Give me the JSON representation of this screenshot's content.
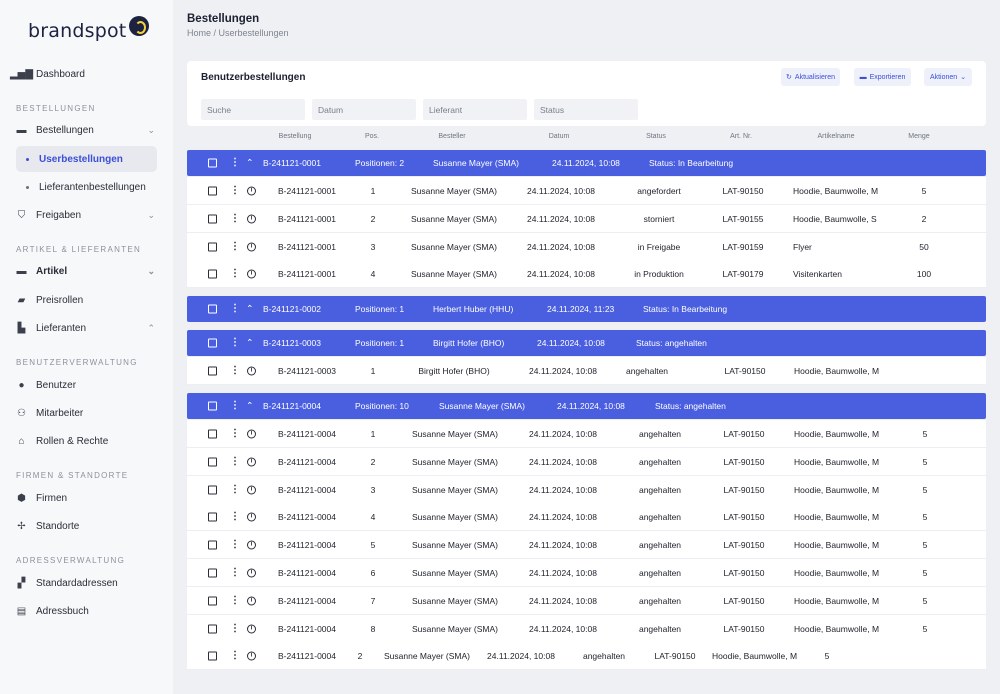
{
  "brand": "brandspot",
  "sidebar": {
    "dashboard": "Dashboard",
    "sections": {
      "bestellungen": "BESTELLUNGEN",
      "artikel": "ARTIKEL & LIEFERANTEN",
      "benutzer": "BENUTZERVERWALTUNG",
      "firmen": "FIRMEN & STANDORTE",
      "adressen": "ADRESSVERWALTUNG"
    },
    "items": {
      "bestellungen": "Bestellungen",
      "userbestellungen": "Userbestellungen",
      "lieferantenbestellungen": "Lieferantenbestellungen",
      "freigaben": "Freigaben",
      "artikel": "Artikel",
      "preisrollen": "Preisrollen",
      "lieferanten": "Lieferanten",
      "benutzer": "Benutzer",
      "mitarbeiter": "Mitarbeiter",
      "rollen": "Rollen & Rechte",
      "firmen": "Firmen",
      "standorte": "Standorte",
      "standardadressen": "Standardadressen",
      "adressbuch": "Adressbuch"
    }
  },
  "header": {
    "title": "Bestellungen",
    "breadcrumb": "Home / Userbestellungen"
  },
  "panel": {
    "title": "Benutzerbestellungen",
    "refresh": "Aktualisieren",
    "export": "Exportieren",
    "actions": "Aktionen",
    "filters": {
      "search": "Suche",
      "date": "Datum",
      "supplier": "Lieferant",
      "status": "Status"
    }
  },
  "columns": {
    "order": "Bestellung",
    "pos": "Pos.",
    "orderer": "Besteller",
    "date": "Datum",
    "status": "Status",
    "artno": "Art. Nr.",
    "artname": "Artikelname",
    "qty": "Menge"
  },
  "rows": [
    {
      "type": "group",
      "order": "B-241121-0001",
      "positions": "Positionen: 2",
      "user": "Susanne Mayer (SMA)",
      "date": "24.11.2024, 10:08",
      "status": "Status: In Bearbeitung"
    },
    {
      "type": "item",
      "order": "B-241121-0001",
      "pos": "1",
      "user": "Susanne Mayer (SMA)",
      "date": "24.11.2024, 10:08",
      "status": "angefordert",
      "artno": "LAT-90150",
      "artname": "Hoodie, Baumwolle, M",
      "qty": "5"
    },
    {
      "type": "item",
      "order": "B-241121-0001",
      "pos": "2",
      "user": "Susanne Mayer (SMA)",
      "date": "24.11.2024, 10:08",
      "status": "storniert",
      "artno": "LAT-90155",
      "artname": "Hoodie, Baumwolle, S",
      "qty": "2"
    },
    {
      "type": "item",
      "order": "B-241121-0001",
      "pos": "3",
      "user": "Susanne Mayer (SMA)",
      "date": "24.11.2024, 10:08",
      "status": "in Freigabe",
      "artno": "LAT-90159",
      "artname": "Flyer",
      "qty": "50"
    },
    {
      "type": "item",
      "order": "B-241121-0001",
      "pos": "4",
      "user": "Susanne Mayer (SMA)",
      "date": "24.11.2024, 10:08",
      "status": "in Produktion",
      "artno": "LAT-90179",
      "artname": "Visitenkarten",
      "qty": "100"
    },
    {
      "type": "group",
      "order": "B-241121-0002",
      "positions": "Positionen: 1",
      "user": "Herbert Huber (HHU)",
      "date": "24.11.2024, 11:23",
      "status": "Status: In Bearbeitung"
    },
    {
      "type": "group",
      "order": "B-241121-0003",
      "positions": "Positionen: 1",
      "user": "Birgitt Hofer (BHO)",
      "date": "24.11.2024, 10:08",
      "status": "Status: angehalten"
    },
    {
      "type": "item",
      "order": "B-241121-0003",
      "pos": "1",
      "user": "Birgitt Hofer (BHO)",
      "date": "24.11.2024, 10:08",
      "status": "angehalten",
      "artno": "LAT-90150",
      "artname": "Hoodie, Baumwolle, M",
      "qty": ""
    },
    {
      "type": "group",
      "order": "B-241121-0004",
      "positions": "Positionen: 10",
      "user": "Susanne Mayer (SMA)",
      "date": "24.11.2024, 10:08",
      "status": "Status: angehalten"
    },
    {
      "type": "item",
      "order": "B-241121-0004",
      "pos": "1",
      "user": "Susanne Mayer (SMA)",
      "date": "24.11.2024, 10:08",
      "status": "angehalten",
      "artno": "LAT-90150",
      "artname": "Hoodie, Baumwolle, M",
      "qty": "5"
    },
    {
      "type": "item",
      "order": "B-241121-0004",
      "pos": "2",
      "user": "Susanne Mayer (SMA)",
      "date": "24.11.2024, 10:08",
      "status": "angehalten",
      "artno": "LAT-90150",
      "artname": "Hoodie, Baumwolle, M",
      "qty": "5"
    },
    {
      "type": "item",
      "order": "B-241121-0004",
      "pos": "3",
      "user": "Susanne Mayer (SMA)",
      "date": "24.11.2024, 10:08",
      "status": "angehalten",
      "artno": "LAT-90150",
      "artname": "Hoodie, Baumwolle, M",
      "qty": "5"
    },
    {
      "type": "item",
      "order": "B-241121-0004",
      "pos": "4",
      "user": "Susanne Mayer (SMA)",
      "date": "24.11.2024, 10:08",
      "status": "angehalten",
      "artno": "LAT-90150",
      "artname": "Hoodie, Baumwolle, M",
      "qty": "5"
    },
    {
      "type": "item",
      "order": "B-241121-0004",
      "pos": "5",
      "user": "Susanne Mayer (SMA)",
      "date": "24.11.2024, 10:08",
      "status": "angehalten",
      "artno": "LAT-90150",
      "artname": "Hoodie, Baumwolle, M",
      "qty": "5"
    },
    {
      "type": "item",
      "order": "B-241121-0004",
      "pos": "6",
      "user": "Susanne Mayer (SMA)",
      "date": "24.11.2024, 10:08",
      "status": "angehalten",
      "artno": "LAT-90150",
      "artname": "Hoodie, Baumwolle, M",
      "qty": "5"
    },
    {
      "type": "item",
      "order": "B-241121-0004",
      "pos": "7",
      "user": "Susanne Mayer (SMA)",
      "date": "24.11.2024, 10:08",
      "status": "angehalten",
      "artno": "LAT-90150",
      "artname": "Hoodie, Baumwolle, M",
      "qty": "5"
    },
    {
      "type": "item",
      "order": "B-241121-0004",
      "pos": "8",
      "user": "Susanne Mayer (SMA)",
      "date": "24.11.2024, 10:08",
      "status": "angehalten",
      "artno": "LAT-90150",
      "artname": "Hoodie, Baumwolle, M",
      "qty": "5"
    },
    {
      "type": "item",
      "order": "B-241121-0004",
      "pos": "2",
      "user": "Susanne Mayer (SMA)",
      "date": "24.11.2024, 10:08",
      "status": "angehalten",
      "artno": "LAT-90150",
      "artname": "Hoodie, Baumwolle, M",
      "qty": "5",
      "shifted": true
    }
  ],
  "colors": {
    "accent": "#3b4fd8",
    "group_row": "#4a5ee0",
    "sidebar_bg": "#f7f8fa",
    "page_bg": "#eef0f4"
  },
  "icons": {
    "refresh": "refresh-icon",
    "export": "folder-icon",
    "actions": "chevron-down-icon"
  }
}
